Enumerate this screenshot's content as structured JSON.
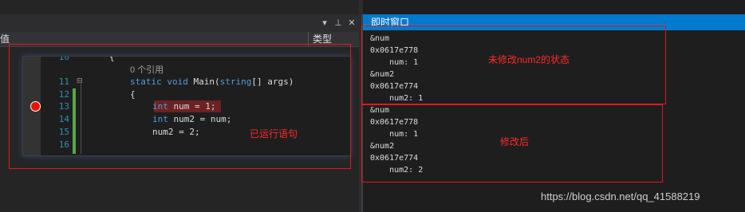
{
  "left_panel": {
    "col_value_header": "值",
    "col_type_header": "类型",
    "toolbar_icons": [
      "chevron-down-icon",
      "pin-icon",
      "close-icon"
    ]
  },
  "code_peek": {
    "lines": [
      {
        "number": "10",
        "text": "{"
      },
      {
        "number": "",
        "text": "0 个引用"
      },
      {
        "number": "11",
        "text": "static void Main(string[] args)"
      },
      {
        "number": "12",
        "text": "{"
      },
      {
        "number": "13",
        "text": "int num = 1;"
      },
      {
        "number": "14",
        "text": "int num2 = num;"
      },
      {
        "number": "15",
        "text": "num2 = 2;"
      },
      {
        "number": "16",
        "text": ""
      }
    ],
    "annotation": "已运行语句"
  },
  "immediate_window": {
    "title": "即时窗口",
    "before_lines": [
      "&num",
      "0x0617e778",
      "    num: 1",
      "&num2",
      "0x0617e774",
      "    num2: 1"
    ],
    "after_lines": [
      "&num",
      "0x0617e778",
      "    num: 1",
      "&num2",
      "0x0617e774",
      "    num2: 2"
    ],
    "before_annotation": "未修改num2的状态",
    "after_annotation": "修改后"
  },
  "watermark": "https://blog.csdn.net/qq_41588219",
  "colors": {
    "accent": "#007acc",
    "annotation_red": "#e0191e",
    "breakpoint_red": "#e51400",
    "change_green": "#57a64a"
  }
}
